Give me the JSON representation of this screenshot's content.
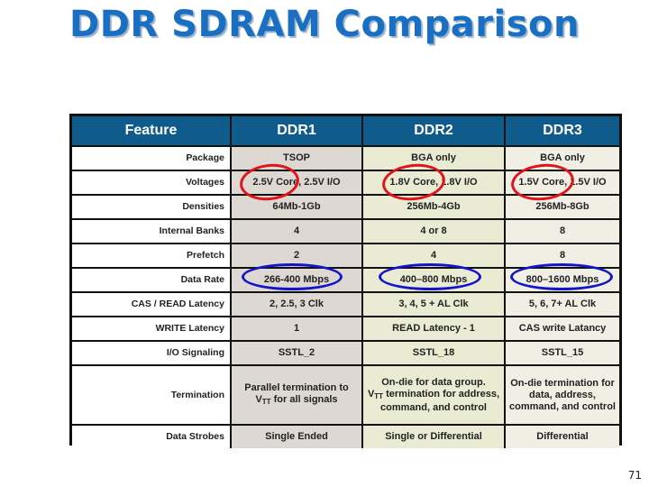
{
  "slide": {
    "title": "DDR SDRAM Comparison",
    "page_number": "71"
  },
  "table": {
    "headers": [
      "Feature",
      "DDR1",
      "DDR2",
      "DDR3"
    ],
    "rows": [
      {
        "feature": "Package",
        "ddr1": "TSOP",
        "ddr2": "BGA only",
        "ddr3": "BGA only"
      },
      {
        "feature": "Voltages",
        "ddr1": "2.5V Core, 2.5V I/O",
        "ddr2": "1.8V Core, 1.8V I/O",
        "ddr3": "1.5V Core, 1.5V I/O"
      },
      {
        "feature": "Densities",
        "ddr1": "64Mb-1Gb",
        "ddr2": "256Mb-4Gb",
        "ddr3": "256Mb-8Gb"
      },
      {
        "feature": "Internal Banks",
        "ddr1": "4",
        "ddr2": "4 or 8",
        "ddr3": "8"
      },
      {
        "feature": "Prefetch",
        "ddr1": "2",
        "ddr2": "4",
        "ddr3": "8"
      },
      {
        "feature": "Data Rate",
        "ddr1": "266-400 Mbps",
        "ddr2": "400–800 Mbps",
        "ddr3": "800–1600 Mbps"
      },
      {
        "feature": "CAS / READ Latency",
        "ddr1": "2, 2.5, 3 Clk",
        "ddr2": "3, 4, 5 + AL Clk",
        "ddr3": "5, 6, 7+ AL Clk"
      },
      {
        "feature": "WRITE Latency",
        "ddr1": "1",
        "ddr2": "READ Latency - 1",
        "ddr3": "CAS write Latancy"
      },
      {
        "feature": "I/O Signaling",
        "ddr1": "SSTL_2",
        "ddr2": "SSTL_18",
        "ddr3": "SSTL_15"
      },
      {
        "feature": "Termination",
        "ddr1_pre": "Parallel termination to",
        "ddr1_v": "V",
        "ddr1_sub": "TT",
        "ddr1_post": " for all signals",
        "ddr2_pre": "On-die for data group.",
        "ddr2_v": "V",
        "ddr2_sub": "TT",
        "ddr2_post": " termination for address, command, and control",
        "ddr3": "On-die termination for data, address, command, and control"
      },
      {
        "feature": "Data Strobes",
        "ddr1": "Single Ended",
        "ddr2": "Single or Differential",
        "ddr3": "Differential"
      }
    ]
  },
  "annotations": {
    "red_circles": [
      "voltages-ddr1",
      "voltages-ddr2",
      "voltages-ddr3"
    ],
    "blue_ellipses": [
      "data-rate-ddr1",
      "data-rate-ddr2",
      "data-rate-ddr3"
    ],
    "colors": {
      "red": "#e0141b",
      "blue": "#1414c8",
      "header": "#0f5b8c",
      "title": "#1a6fc2"
    }
  }
}
